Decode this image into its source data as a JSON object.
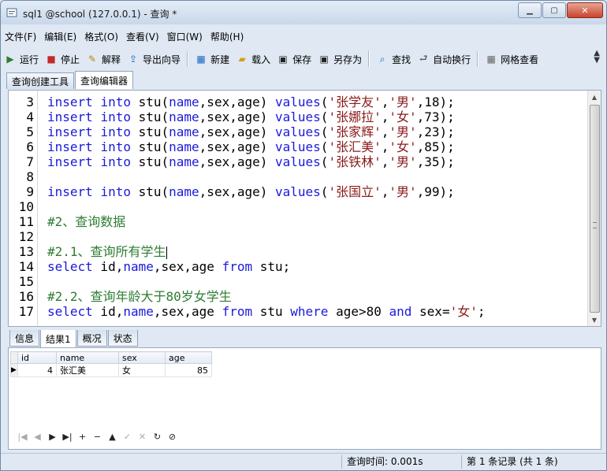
{
  "window": {
    "title": "sql1 @school (127.0.0.1) - 查询 *",
    "controls": {
      "minimize": "▁",
      "maximize": "▢",
      "close": "✕"
    }
  },
  "menu": [
    "文件(F)",
    "编辑(E)",
    "格式(O)",
    "查看(V)",
    "窗口(W)",
    "帮助(H)"
  ],
  "toolbar": [
    {
      "label": "运行",
      "icon": "run-icon",
      "glyph": "▶",
      "color": "#2e7d32"
    },
    {
      "label": "停止",
      "icon": "stop-icon",
      "glyph": "■",
      "color": "#c62828"
    },
    {
      "label": "解释",
      "icon": "explain-icon",
      "glyph": "✎",
      "color": "#b8860b"
    },
    {
      "label": "导出向导",
      "icon": "export-icon",
      "glyph": "⇪",
      "color": "#1565c0"
    },
    {
      "label": "新建",
      "icon": "new-icon",
      "glyph": "▦",
      "color": "#1565c0"
    },
    {
      "label": "载入",
      "icon": "load-icon",
      "glyph": "▰",
      "color": "#d4a017"
    },
    {
      "label": "保存",
      "icon": "save-icon",
      "glyph": "▣",
      "color": "#222222"
    },
    {
      "label": "另存为",
      "icon": "saveas-icon",
      "glyph": "▣",
      "color": "#222222"
    },
    {
      "label": "查找",
      "icon": "find-icon",
      "glyph": "⌕",
      "color": "#1565c0"
    },
    {
      "label": "自动换行",
      "icon": "wrap-icon",
      "glyph": "⮐",
      "color": "#555555"
    },
    {
      "label": "网格查看",
      "icon": "grid-icon",
      "glyph": "▦",
      "color": "#666666"
    }
  ],
  "tabs_top": [
    "查询创建工具",
    "查询编辑器"
  ],
  "active_top_tab": 1,
  "editor_lines": [
    {
      "n": "3",
      "tokens": [
        [
          "kw",
          "insert"
        ],
        [
          "txt",
          " "
        ],
        [
          "kw",
          "into"
        ],
        [
          "txt",
          " stu("
        ],
        [
          "kw",
          "name"
        ],
        [
          "txt",
          ",sex,age) "
        ],
        [
          "kw",
          "values"
        ],
        [
          "txt",
          "("
        ],
        [
          "str",
          "'张学友'"
        ],
        [
          "txt",
          ","
        ],
        [
          "str",
          "'男'"
        ],
        [
          "txt",
          ",18);"
        ]
      ]
    },
    {
      "n": "4",
      "tokens": [
        [
          "kw",
          "insert"
        ],
        [
          "txt",
          " "
        ],
        [
          "kw",
          "into"
        ],
        [
          "txt",
          " stu("
        ],
        [
          "kw",
          "name"
        ],
        [
          "txt",
          ",sex,age) "
        ],
        [
          "kw",
          "values"
        ],
        [
          "txt",
          "("
        ],
        [
          "str",
          "'张娜拉'"
        ],
        [
          "txt",
          ","
        ],
        [
          "str",
          "'女'"
        ],
        [
          "txt",
          ",73);"
        ]
      ]
    },
    {
      "n": "5",
      "tokens": [
        [
          "kw",
          "insert"
        ],
        [
          "txt",
          " "
        ],
        [
          "kw",
          "into"
        ],
        [
          "txt",
          " stu("
        ],
        [
          "kw",
          "name"
        ],
        [
          "txt",
          ",sex,age) "
        ],
        [
          "kw",
          "values"
        ],
        [
          "txt",
          "("
        ],
        [
          "str",
          "'张家辉'"
        ],
        [
          "txt",
          ","
        ],
        [
          "str",
          "'男'"
        ],
        [
          "txt",
          ",23);"
        ]
      ]
    },
    {
      "n": "6",
      "tokens": [
        [
          "kw",
          "insert"
        ],
        [
          "txt",
          " "
        ],
        [
          "kw",
          "into"
        ],
        [
          "txt",
          " stu("
        ],
        [
          "kw",
          "name"
        ],
        [
          "txt",
          ",sex,age) "
        ],
        [
          "kw",
          "values"
        ],
        [
          "txt",
          "("
        ],
        [
          "str",
          "'张汇美'"
        ],
        [
          "txt",
          ","
        ],
        [
          "str",
          "'女'"
        ],
        [
          "txt",
          ",85);"
        ]
      ]
    },
    {
      "n": "7",
      "tokens": [
        [
          "kw",
          "insert"
        ],
        [
          "txt",
          " "
        ],
        [
          "kw",
          "into"
        ],
        [
          "txt",
          " stu("
        ],
        [
          "kw",
          "name"
        ],
        [
          "txt",
          ",sex,age) "
        ],
        [
          "kw",
          "values"
        ],
        [
          "txt",
          "("
        ],
        [
          "str",
          "'张铁林'"
        ],
        [
          "txt",
          ","
        ],
        [
          "str",
          "'男'"
        ],
        [
          "txt",
          ",35);"
        ]
      ]
    },
    {
      "n": "8",
      "tokens": []
    },
    {
      "n": "9",
      "tokens": [
        [
          "kw",
          "insert"
        ],
        [
          "txt",
          " "
        ],
        [
          "kw",
          "into"
        ],
        [
          "txt",
          " stu("
        ],
        [
          "kw",
          "name"
        ],
        [
          "txt",
          ",sex,age) "
        ],
        [
          "kw",
          "values"
        ],
        [
          "txt",
          "("
        ],
        [
          "str",
          "'张国立'"
        ],
        [
          "txt",
          ","
        ],
        [
          "str",
          "'男'"
        ],
        [
          "txt",
          ",99);"
        ]
      ]
    },
    {
      "n": "10",
      "tokens": []
    },
    {
      "n": "11",
      "tokens": [
        [
          "cm",
          "#2、查询数据"
        ]
      ]
    },
    {
      "n": "12",
      "tokens": []
    },
    {
      "n": "13",
      "tokens": [
        [
          "cm",
          "#2.1、查询所有学生"
        ]
      ],
      "cursor": true
    },
    {
      "n": "14",
      "tokens": [
        [
          "kw",
          "select"
        ],
        [
          "txt",
          " id,"
        ],
        [
          "kw",
          "name"
        ],
        [
          "txt",
          ",sex,age "
        ],
        [
          "kw",
          "from"
        ],
        [
          "txt",
          " stu;"
        ]
      ]
    },
    {
      "n": "15",
      "tokens": []
    },
    {
      "n": "16",
      "tokens": [
        [
          "cm",
          "#2.2、查询年龄大于80岁女学生"
        ]
      ]
    },
    {
      "n": "17",
      "tokens": [
        [
          "kw",
          "select"
        ],
        [
          "txt",
          " id,"
        ],
        [
          "kw",
          "name"
        ],
        [
          "txt",
          ",sex,age "
        ],
        [
          "kw",
          "from"
        ],
        [
          "txt",
          " stu "
        ],
        [
          "kw",
          "where"
        ],
        [
          "txt",
          " age>80 "
        ],
        [
          "kw",
          "and"
        ],
        [
          "txt",
          " sex="
        ],
        [
          "str",
          "'女'"
        ],
        [
          "txt",
          ";"
        ]
      ]
    }
  ],
  "tabs_bottom": [
    "信息",
    "结果1",
    "概况",
    "状态"
  ],
  "active_bottom_tab": 1,
  "result": {
    "columns": [
      "id",
      "name",
      "sex",
      "age"
    ],
    "rows": [
      [
        "4",
        "张汇美",
        "女",
        "85"
      ]
    ]
  },
  "grid_nav": [
    "|◀",
    "◀",
    "▶",
    "▶|",
    "+",
    "−",
    "▲",
    "✓",
    "✕",
    "↻",
    "⊘"
  ],
  "grid_nav_disabled": [
    0,
    1,
    7,
    8
  ],
  "status": {
    "query_time": "查询时间: 0.001s",
    "records": "第 1 条记录 (共 1 条)"
  }
}
